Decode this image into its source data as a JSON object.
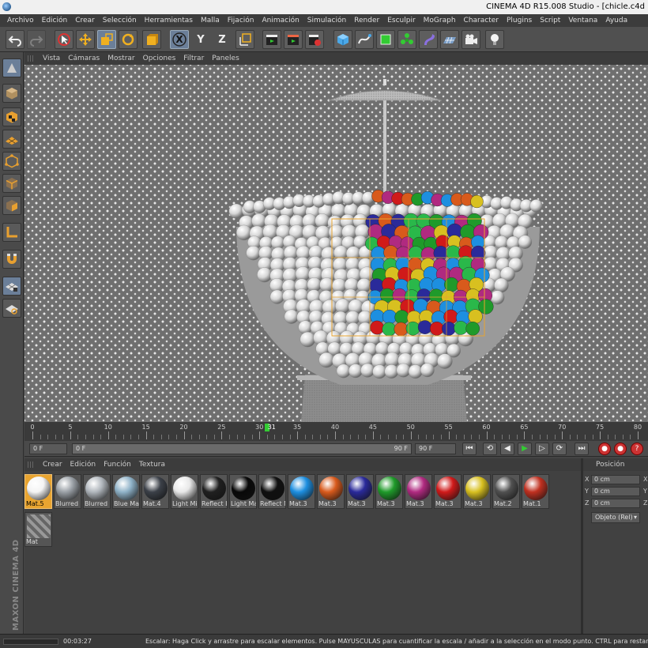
{
  "window": {
    "title": "CINEMA 4D R15.008 Studio - [chicle.c4d"
  },
  "menu": [
    "Archivo",
    "Edición",
    "Crear",
    "Selección",
    "Herramientas",
    "Malla",
    "Fijación",
    "Animación",
    "Simulación",
    "Render",
    "Esculpir",
    "MoGraph",
    "Character",
    "Plugins",
    "Script",
    "Ventana",
    "Ayuda"
  ],
  "toolbar": {
    "x_label": "X",
    "y_label": "Y",
    "z_label": "Z"
  },
  "viewport_menu": [
    "Vista",
    "Cámaras",
    "Mostrar",
    "Opciones",
    "Filtrar",
    "Paneles"
  ],
  "timeline": {
    "ticks": [
      "0",
      "5",
      "10",
      "15",
      "20",
      "25",
      "30",
      "31",
      "35",
      "40",
      "45",
      "50",
      "55",
      "60",
      "65",
      "70",
      "75",
      "80"
    ],
    "current_frame": 31,
    "start_field": "0 F",
    "range_start": "0 F",
    "range_end": "90 F",
    "end_field": "90 F"
  },
  "material_menu": [
    "Crear",
    "Edición",
    "Función",
    "Textura"
  ],
  "materials": [
    {
      "label": "Mat.5",
      "color": "#f4f4f4",
      "selected": true
    },
    {
      "label": "Blurred",
      "color": "#9aa0a6"
    },
    {
      "label": "Blurred",
      "color": "#b0b6bc"
    },
    {
      "label": "Blue Ma",
      "color": "#8fb2c8"
    },
    {
      "label": "Mat.4",
      "color": "#3b4048"
    },
    {
      "label": "Light Mi",
      "color": "#e8e8e8"
    },
    {
      "label": "Reflect I",
      "color": "#202020"
    },
    {
      "label": "Light Ma",
      "color": "#080808"
    },
    {
      "label": "Reflect M",
      "color": "#101010"
    },
    {
      "label": "Mat.3",
      "color": "#1d8fe0"
    },
    {
      "label": "Mat.3",
      "color": "#d85a1c"
    },
    {
      "label": "Mat.3",
      "color": "#2a2a9a"
    },
    {
      "label": "Mat.3",
      "color": "#1f9a2a"
    },
    {
      "label": "Mat.3",
      "color": "#b02a80"
    },
    {
      "label": "Mat.3",
      "color": "#d01a1a"
    },
    {
      "label": "Mat.3",
      "color": "#d8c020"
    },
    {
      "label": "Mat.2",
      "color": "#505050"
    },
    {
      "label": "Mat.1",
      "color": "#c03020"
    },
    {
      "label": "Mat",
      "color": "#888888"
    }
  ],
  "position": {
    "header": "Posición",
    "x_axis": "X",
    "x_value": "0 cm",
    "x_trailing": "X",
    "y_axis": "Y",
    "y_value": "0 cm",
    "y_trailing": "Y",
    "z_axis": "Z",
    "z_value": "0 cm",
    "z_trailing": "Z",
    "mode": "Objeto (Rel)"
  },
  "status": {
    "time": "00:03:27",
    "message": "Escalar: Haga Click y arrastre para escalar elementos. Pulse MAYUSCULAS para cuantificar la escala / añadir a la selección en el modo punto. CTRL para restar."
  },
  "branding": {
    "logo": "MAXON CINEMA 4D"
  },
  "colors": {
    "accent": "#e8a430",
    "active": "#6b7f99",
    "playhead": "#33cc33"
  }
}
